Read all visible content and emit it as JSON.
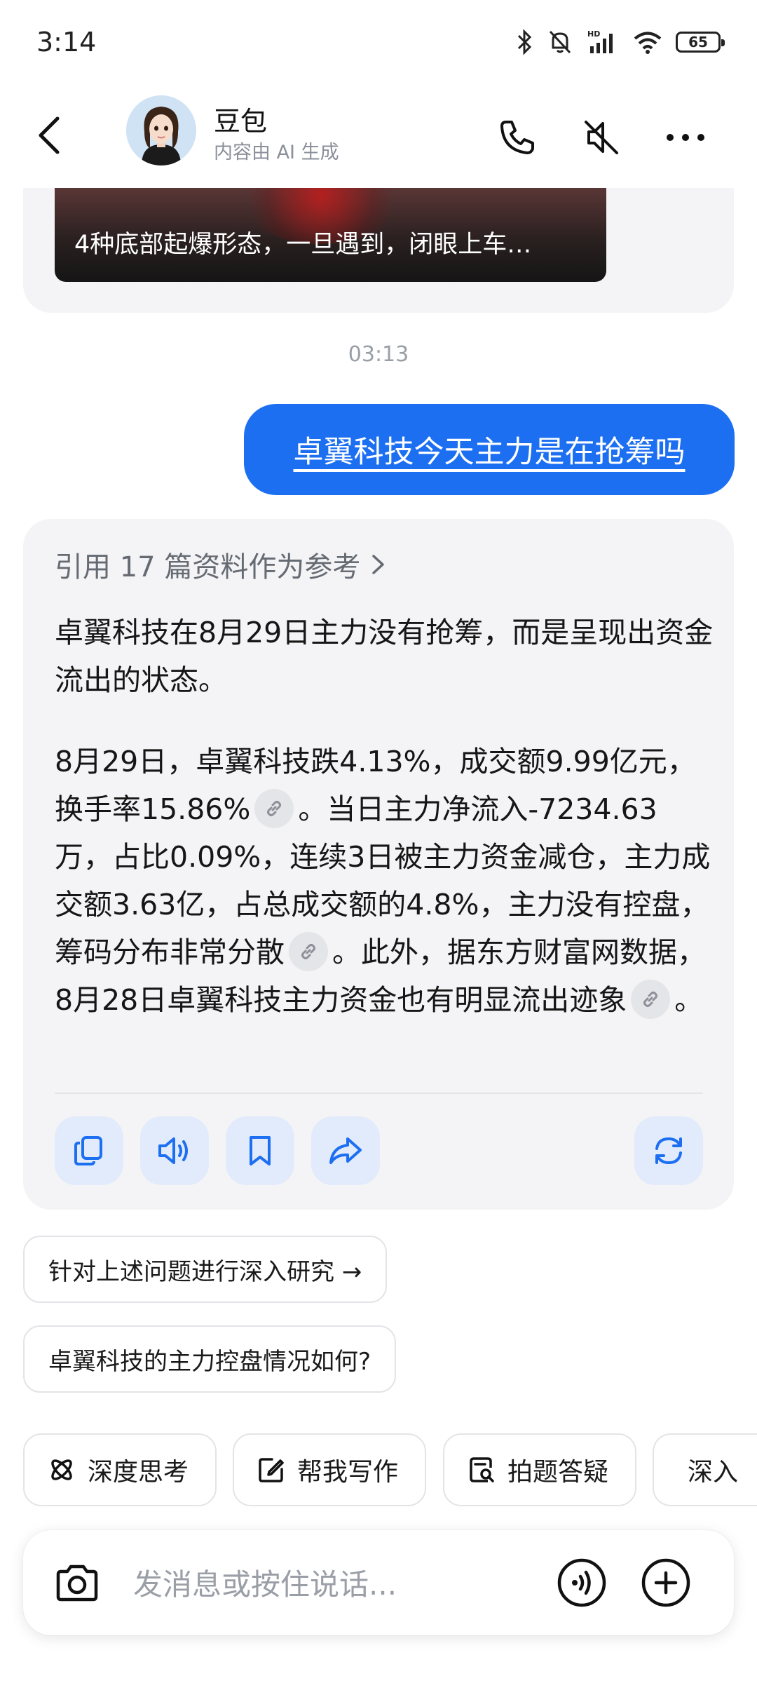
{
  "status_bar": {
    "time": "3:14",
    "battery": "65",
    "icons": [
      "bluetooth-icon",
      "mute-bell-icon",
      "hd-signal-icon",
      "wifi-icon",
      "battery-icon"
    ]
  },
  "header": {
    "name": "豆包",
    "subtitle": "内容由 AI 生成",
    "icons": [
      "back-icon",
      "phone-icon",
      "speaker-mute-icon",
      "more-icon"
    ]
  },
  "previous_message": {
    "video_caption": "4种底部起爆形态，一旦遇到，闭眼上车…"
  },
  "timestamp": "03:13",
  "user_message": "卓翼科技今天主力是在抢筹吗",
  "ai_message": {
    "reference_label": "引用 17 篇资料作为参考",
    "paragraph1": "卓翼科技在8月29日主力没有抢筹，而是呈现出资金流出的状态。",
    "p2_part1": "8月29日，卓翼科技跌4.13%，成交额9.99亿元，换手率15.86%",
    "p2_part2": "。当日主力净流入-7234.63万，占比0.09%，连续3日被主力资金减仓，主力成交额3.63亿，占总成交额的4.8%，主力没有控盘，筹码分布非常分散",
    "p2_part3": "。此外，据东方财富网数据，8月28日卓翼科技主力资金也有明显流出迹象",
    "p2_part4": "。",
    "actions": [
      "copy-icon",
      "read-aloud-icon",
      "bookmark-icon",
      "share-icon",
      "regenerate-icon"
    ]
  },
  "suggestions": [
    "针对上述问题进行深入研究 →",
    "卓翼科技的主力控盘情况如何?"
  ],
  "tools": [
    {
      "label": "深度思考",
      "icon": "atom-icon"
    },
    {
      "label": "帮我写作",
      "icon": "edit-icon"
    },
    {
      "label": "拍题答疑",
      "icon": "scan-question-icon"
    },
    {
      "label": "深入",
      "icon": "telescope-icon"
    }
  ],
  "input": {
    "placeholder": "发消息或按住说话..."
  },
  "colors": {
    "accent": "#1d6ff2",
    "card_bg": "#f4f4f6",
    "action_bg": "#e2ebfb"
  }
}
